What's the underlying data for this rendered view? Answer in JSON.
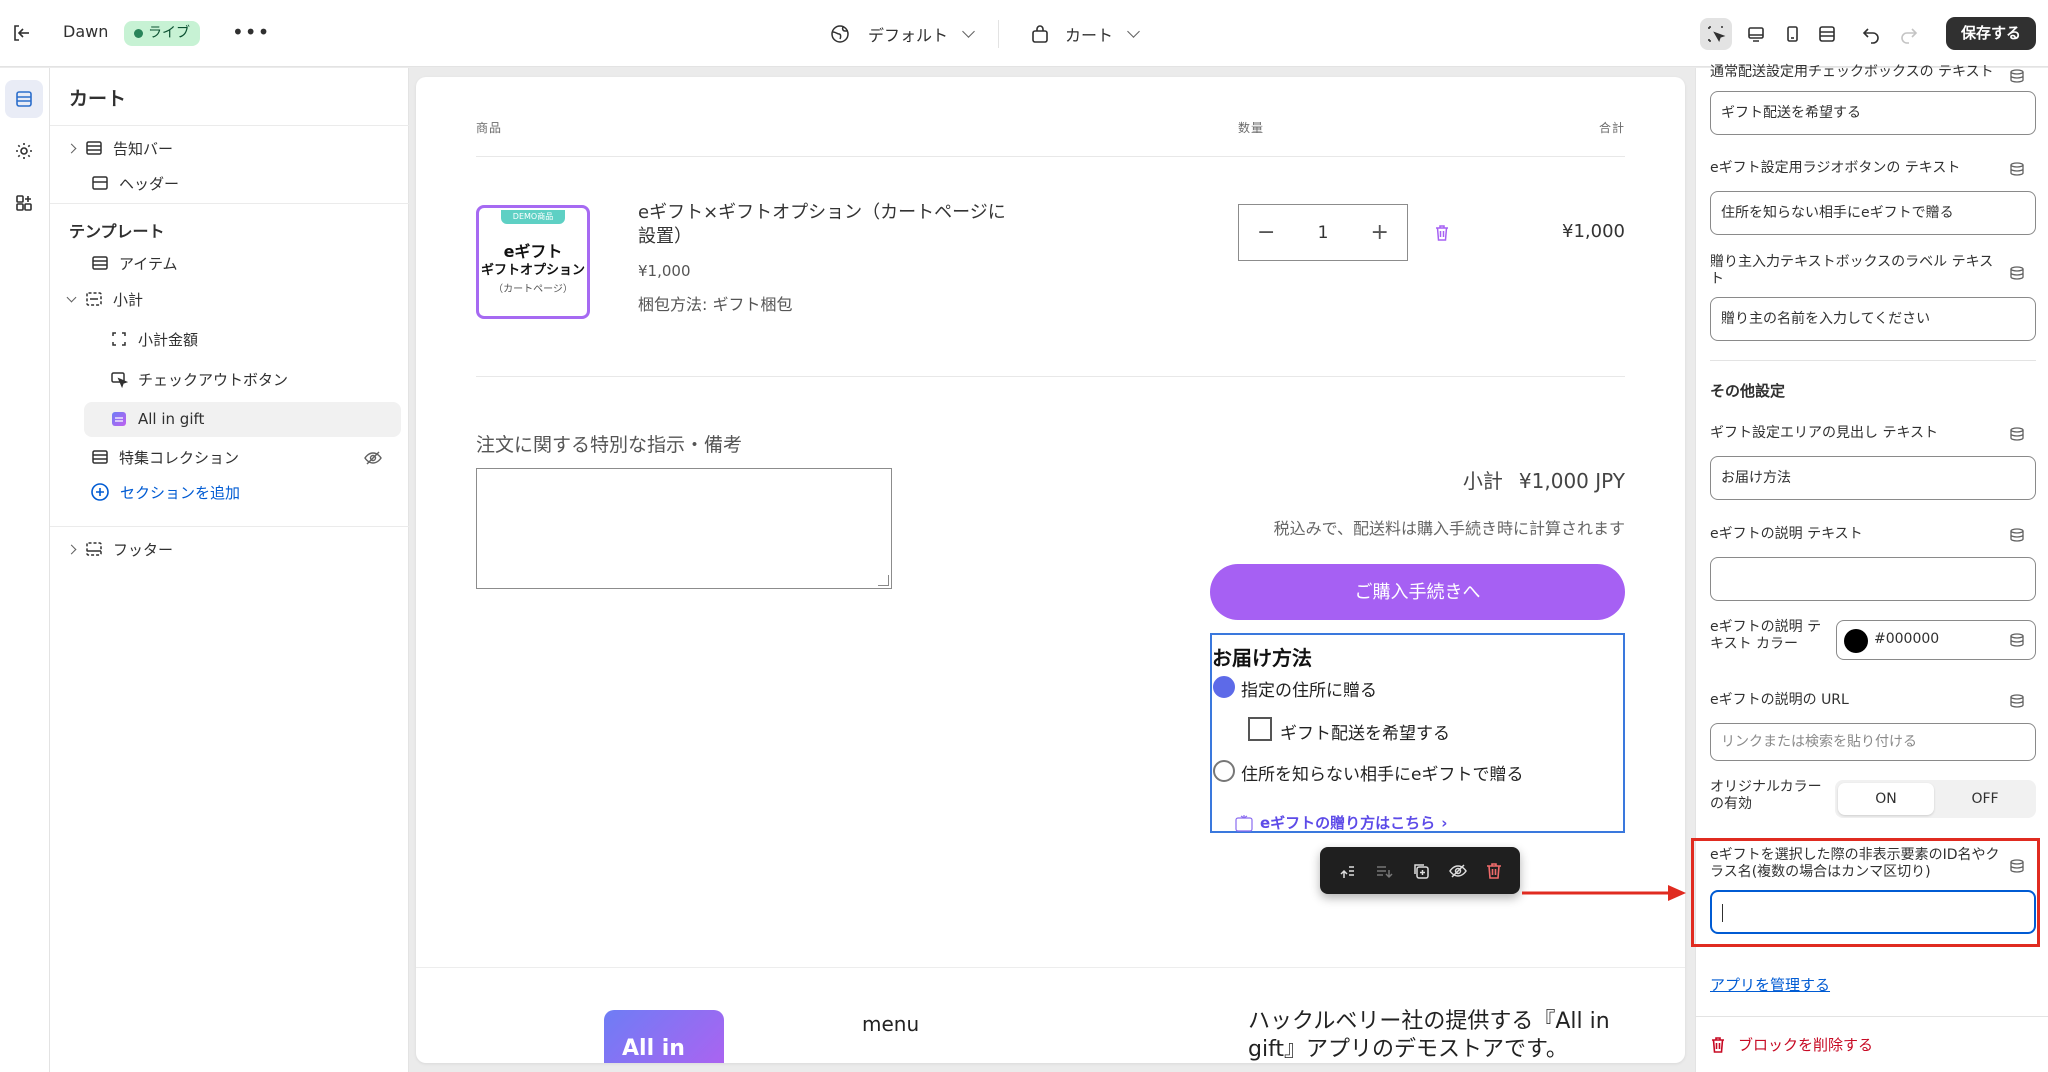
{
  "topbar": {
    "theme_name": "Dawn",
    "live_badge": "ライブ",
    "more": "•••",
    "template_selector": "デフォルト",
    "page_selector": "カート",
    "save_label": "保存する"
  },
  "sidebar": {
    "title": "カート",
    "header_items": [
      {
        "label": "告知バー"
      },
      {
        "label": "ヘッダー"
      }
    ],
    "template_heading": "テンプレート",
    "template_items": [
      {
        "label": "アイテム"
      },
      {
        "label": "小計"
      },
      {
        "label": "小計金額"
      },
      {
        "label": "チェックアウトボタン"
      },
      {
        "label": "All in gift"
      },
      {
        "label": "特集コレクション"
      }
    ],
    "add_section": "セクションを追加",
    "footer_item": "フッター"
  },
  "preview": {
    "table_headers": {
      "product": "商品",
      "quantity": "数量",
      "total": "合計"
    },
    "thumb": {
      "demo": "DEMO商品",
      "line1": "eギフト",
      "line2": "ギフトオプション",
      "line3": "（カートページ）"
    },
    "product_name": "eギフト×ギフトオプション（カートページに設置）",
    "product_price": "¥1,000",
    "product_option": "梱包方法: ギフト梱包",
    "quantity": "1",
    "minus": "−",
    "plus": "+",
    "line_total": "¥1,000",
    "note_label": "注文に関する特別な指示・備考",
    "subtotal_label": "小計",
    "subtotal_value": "¥1,000 JPY",
    "tax_note": "税込みで、配送料は購入手続き時に計算されます",
    "checkout": "ご購入手続きへ",
    "gift": {
      "title": "お届け方法",
      "option1": "指定の住所に贈る",
      "checkbox": "ギフト配送を希望する",
      "option2": "住所を知らない相手にeギフトで贈る",
      "link": "eギフトの贈り方はこちら",
      "link_icon_text": "All in gift"
    },
    "footer": {
      "logo_text": "All in",
      "menu": "menu",
      "about": "ハックルベリー社の提供する『All in gift』アプリのデモストアです。"
    }
  },
  "settings": {
    "top_cut_label": "通常配送設定用チェックボックスの テキスト",
    "checkbox_text_value": "ギフト配送を希望する",
    "radio_label": "eギフト設定用ラジオボタンの テキスト",
    "radio_value": "住所を知らない相手にeギフトで贈る",
    "giver_label": "贈り主入力テキストボックスのラベル テキスト",
    "giver_value": "贈り主の名前を入力してください",
    "other_heading": "その他設定",
    "area_heading_label": "ギフト設定エリアの見出し テキスト",
    "area_heading_value": "お届け方法",
    "desc_text_label": "eギフトの説明 テキスト",
    "desc_text_value": "",
    "desc_color_label": "eギフトの説明 テキスト カラー",
    "desc_color_value": "#000000",
    "desc_url_label": "eギフトの説明の URL",
    "desc_url_placeholder": "リンクまたは検索を貼り付ける",
    "original_color_label": "オリジナルカラーの有効",
    "on_label": "ON",
    "off_label": "OFF",
    "hidden_ids_label": "eギフトを選択した際の非表示要素のID名やクラス名(複数の場合はカンマ区切り)",
    "hidden_ids_value": "",
    "manage_app": "アプリを管理する",
    "delete_block": "ブロックを削除する"
  },
  "colors": {
    "accent_purple": "#a660f3",
    "focus_blue": "#005bd3",
    "annotation_red": "#e02b20",
    "live_green": "#c7f2d4"
  },
  "icons": [
    "exit-icon",
    "globe-icon",
    "bag-icon",
    "inspector-icon",
    "desktop-icon",
    "mobile-icon",
    "fullwidth-icon",
    "undo-icon",
    "redo-icon",
    "sections-icon",
    "settings-icon",
    "apps-icon",
    "database-icon",
    "trash-icon",
    "eye-off-icon"
  ]
}
